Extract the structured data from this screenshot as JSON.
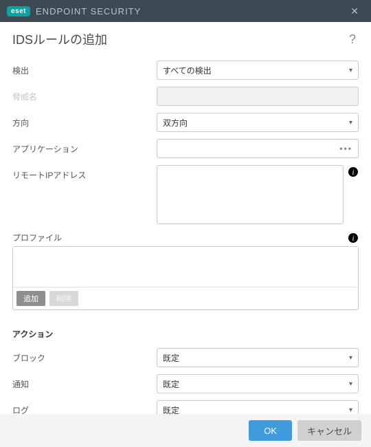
{
  "titlebar": {
    "logo": "eset",
    "product": "ENDPOINT SECURITY"
  },
  "heading": "IDSルールの追加",
  "labels": {
    "detection": "検出",
    "threat_name": "脅威名",
    "direction": "方向",
    "application": "アプリケーション",
    "remote_ip": "リモートIPアドレス",
    "profile": "プロファイル",
    "action_section": "アクション",
    "block": "ブロック",
    "notify": "通知",
    "log": "ログ"
  },
  "values": {
    "detection": "すべての検出",
    "threat_name": "",
    "direction": "双方向",
    "application": "",
    "remote_ip": "",
    "block": "既定",
    "notify": "既定",
    "log": "既定"
  },
  "buttons": {
    "add": "追加",
    "delete": "削除",
    "ok": "OK",
    "cancel": "キャンセル"
  }
}
